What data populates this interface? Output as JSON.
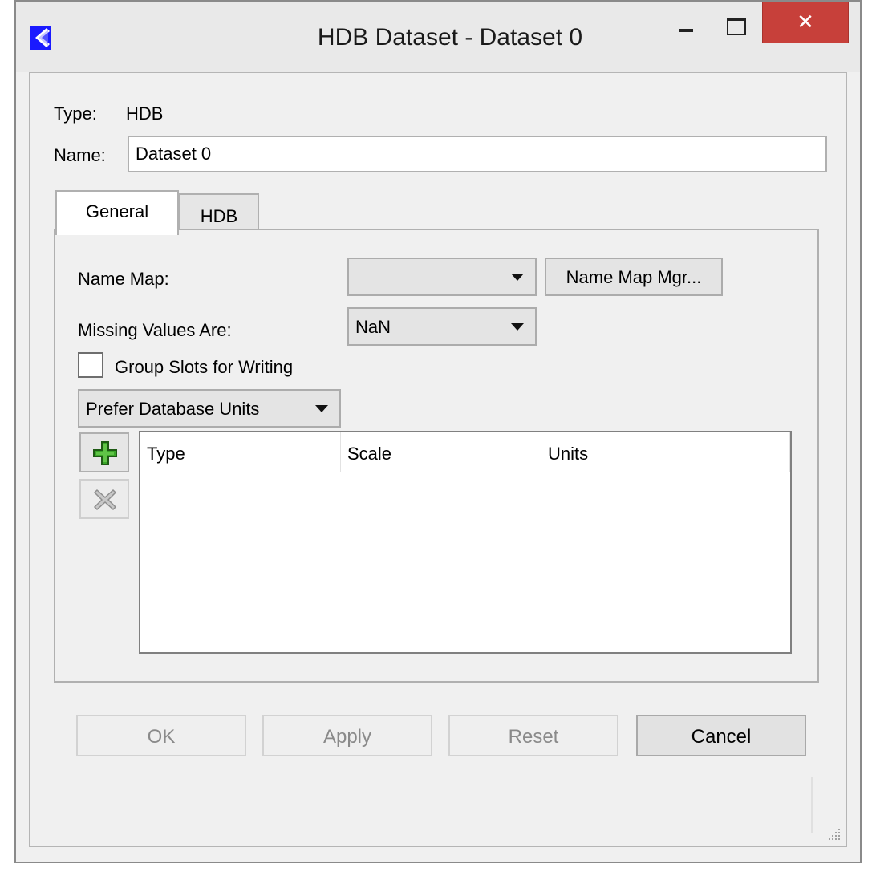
{
  "window": {
    "title": "HDB Dataset - Dataset 0",
    "close_glyph": "✕"
  },
  "fields": {
    "type_label": "Type:",
    "type_value": "HDB",
    "name_label": "Name:",
    "name_value": "Dataset 0"
  },
  "tabs": [
    {
      "label": "General",
      "active": true
    },
    {
      "label": "HDB",
      "active": false
    }
  ],
  "general": {
    "name_map_label": "Name Map:",
    "name_map_value": "",
    "name_map_mgr_label": "Name Map Mgr...",
    "missing_values_label": "Missing Values Are:",
    "missing_values_value": "NaN",
    "group_slots_label": "Group Slots for Writing",
    "group_slots_checked": false,
    "units_mode_value": "Prefer Database Units",
    "table": {
      "columns": [
        "Type",
        "Scale",
        "Units"
      ],
      "rows": []
    }
  },
  "buttons": {
    "ok": "OK",
    "apply": "Apply",
    "reset": "Reset",
    "cancel": "Cancel"
  },
  "colors": {
    "close_button": "#c7403a",
    "add_icon": "#3aa628",
    "app_icon": "#1a1aff"
  }
}
